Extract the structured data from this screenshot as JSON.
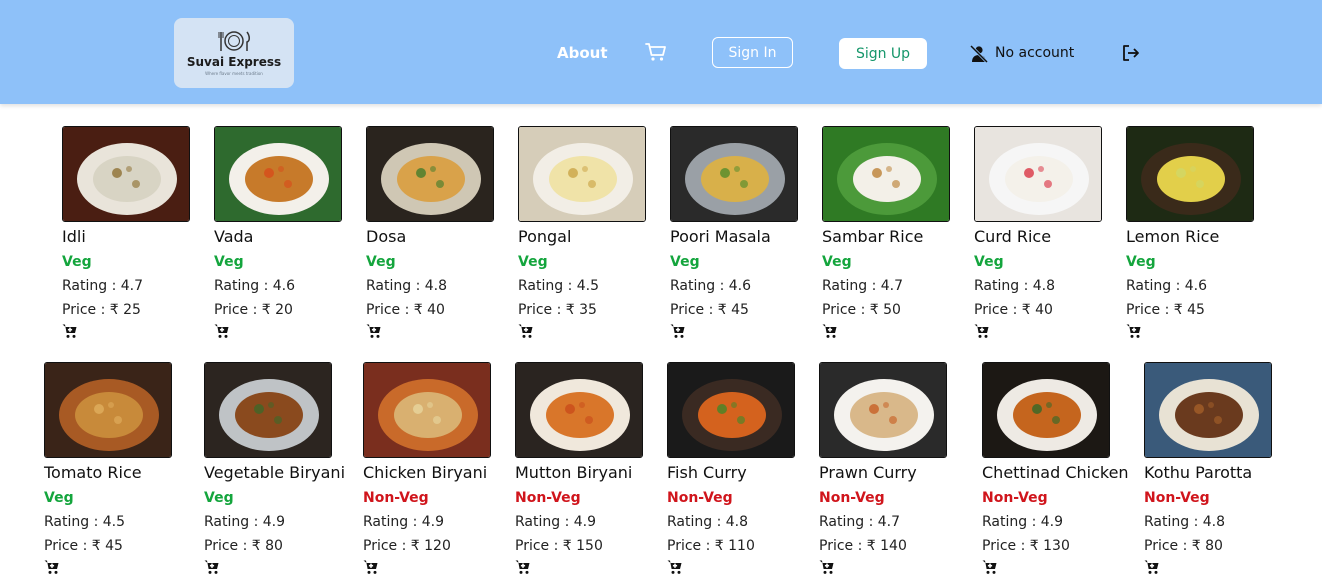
{
  "brand": {
    "name": "Suvai Express",
    "tagline": "Where flavor meets tradition"
  },
  "nav": {
    "about": "About",
    "sign_in": "Sign In",
    "sign_up": "Sign Up",
    "account_status": "No account"
  },
  "colors": {
    "navbar": "#8ec1f9",
    "veg": "#14a53d",
    "non_veg": "#d0151c",
    "sign_up_text": "#15966a"
  },
  "labels": {
    "rating_prefix": "Rating : ",
    "price_prefix": "Price : ₹ "
  },
  "dishes": [
    {
      "name": "Idli",
      "type": "Veg",
      "rating": "4.7",
      "price": "25"
    },
    {
      "name": "Vada",
      "type": "Veg",
      "rating": "4.6",
      "price": "20"
    },
    {
      "name": "Dosa",
      "type": "Veg",
      "rating": "4.8",
      "price": "40"
    },
    {
      "name": "Pongal",
      "type": "Veg",
      "rating": "4.5",
      "price": "35"
    },
    {
      "name": "Poori Masala",
      "type": "Veg",
      "rating": "4.6",
      "price": "45"
    },
    {
      "name": "Sambar Rice",
      "type": "Veg",
      "rating": "4.7",
      "price": "50"
    },
    {
      "name": "Curd Rice",
      "type": "Veg",
      "rating": "4.8",
      "price": "40"
    },
    {
      "name": "Lemon Rice",
      "type": "Veg",
      "rating": "4.6",
      "price": "45"
    },
    {
      "name": "Tomato Rice",
      "type": "Veg",
      "rating": "4.5",
      "price": "45"
    },
    {
      "name": "Vegetable Biryani",
      "type": "Veg",
      "rating": "4.9",
      "price": "80"
    },
    {
      "name": "Chicken Biryani",
      "type": "Non-Veg",
      "rating": "4.9",
      "price": "120"
    },
    {
      "name": "Mutton Biryani",
      "type": "Non-Veg",
      "rating": "4.9",
      "price": "150"
    },
    {
      "name": "Fish Curry",
      "type": "Non-Veg",
      "rating": "4.8",
      "price": "110"
    },
    {
      "name": "Prawn Curry",
      "type": "Non-Veg",
      "rating": "4.7",
      "price": "140"
    },
    {
      "name": "Chettinad Chicken",
      "type": "Non-Veg",
      "rating": "4.9",
      "price": "130"
    },
    {
      "name": "Kothu Parotta",
      "type": "Non-Veg",
      "rating": "4.8",
      "price": "80"
    }
  ]
}
